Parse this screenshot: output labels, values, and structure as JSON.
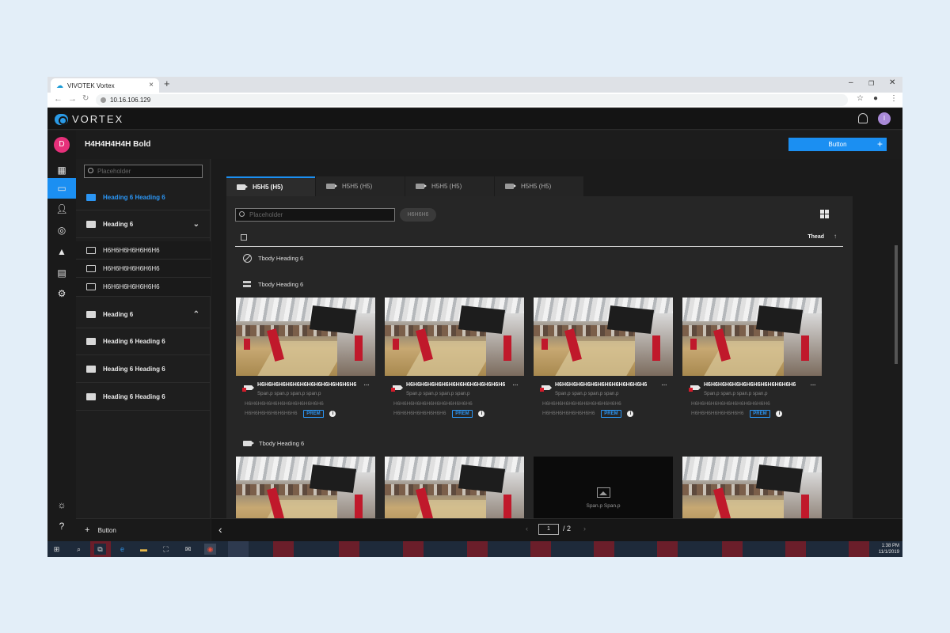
{
  "browser": {
    "tab_title": "VIVOTEK Vortex",
    "url": "10.16.106.129",
    "new_tab_glyph": "+",
    "close_glyph": "×",
    "minimize_glyph": "–",
    "restore_glyph": "❐",
    "window_close_glyph": "✕"
  },
  "app": {
    "brand": "VORTEX",
    "user_initial_top": "I",
    "rail_avatar_initial": "D"
  },
  "header": {
    "title": "H4H4H4H4H Bold",
    "button_label": "Button",
    "button_plus": "+"
  },
  "sidebar": {
    "search_placeholder": "Placeholder",
    "items": [
      {
        "label": "Heading 6 Heading 6"
      },
      {
        "label": "Heading 6",
        "chevron": "⌄"
      },
      {
        "label": "H6H6H6H6H6H6H6"
      },
      {
        "label": "H6H6H6H6H6H6H6"
      },
      {
        "label": "H6H6H6H6H6H6H6"
      },
      {
        "label": "Heading 6",
        "chevron": "⌃"
      },
      {
        "label": "Heading 6 Heading 6"
      },
      {
        "label": "Heading 6 Heading 6"
      },
      {
        "label": "Heading 6 Heading 6"
      }
    ],
    "footer_button": "Button"
  },
  "tabs": [
    {
      "label": "H5H5 (H5)"
    },
    {
      "label": "H5H5 (H5)"
    },
    {
      "label": "H5H5 (H5)"
    },
    {
      "label": "H5H5 (H5)"
    }
  ],
  "panel": {
    "search_placeholder": "Placeholder",
    "chip": "H6H6H6",
    "thead_label": "Thead",
    "sort_arrow": "↑",
    "groups": [
      {
        "label": "Tbody Heading 6"
      },
      {
        "label": "Tbody Heading 6"
      },
      {
        "label": "Tbody Heading 6"
      }
    ],
    "cards_row1": [
      {
        "title": "H6H6H6H6H6H6H6H6H6H6H6H6H6H6",
        "sub": "Span.p span.p span.p span.p",
        "line1": "H6H6H6H6H6H6H6H6H6H6H6H6",
        "line2": "H6H6H6H6H6H6H6H6",
        "badge": "PREM",
        "info": "i",
        "more": "···"
      },
      {
        "title": "H6H6H6H6H6H6H6H6H6H6H6H6H6H6",
        "sub": "Span.p span.p span.p span.p",
        "line1": "H6H6H6H6H6H6H6H6H6H6H6H6",
        "line2": "H6H6H6H6H6H6H6H6",
        "badge": "PREM",
        "info": "i",
        "more": "···"
      },
      {
        "title": "H6H6H6H6H6H6H6H6H6H6H6H6H6",
        "sub": "Span.p span.p span.p span.p",
        "line1": "H6H6H6H6H6H6H6H6H6H6H6H6",
        "line2": "H6H6H6H6H6H6H6H6",
        "badge": "PREM",
        "info": "i",
        "more": "···"
      },
      {
        "title": "H6H6H6H6H6H6H6H6H6H6H6H6H6",
        "sub": "Span.p span.p span.p span.p",
        "line1": "H6H6H6H6H6H6H6H6H6H6H6H6",
        "line2": "H6H6H6H6H6H6H6H6",
        "badge": "PREM",
        "info": "i",
        "more": "···"
      }
    ],
    "empty_card_text": "Span.p Span.p"
  },
  "pager": {
    "back": "‹",
    "prev": "‹",
    "page": "1",
    "total": "/ 2",
    "next": "›"
  },
  "taskbar": {
    "time": "1:38 PM",
    "date": "11/1/2019"
  },
  "colors": {
    "accent": "#1b8ff2",
    "avatar_pink": "#e6307a",
    "avatar_purple": "#a98ad8",
    "brand_logo": "#2a9ae6"
  }
}
